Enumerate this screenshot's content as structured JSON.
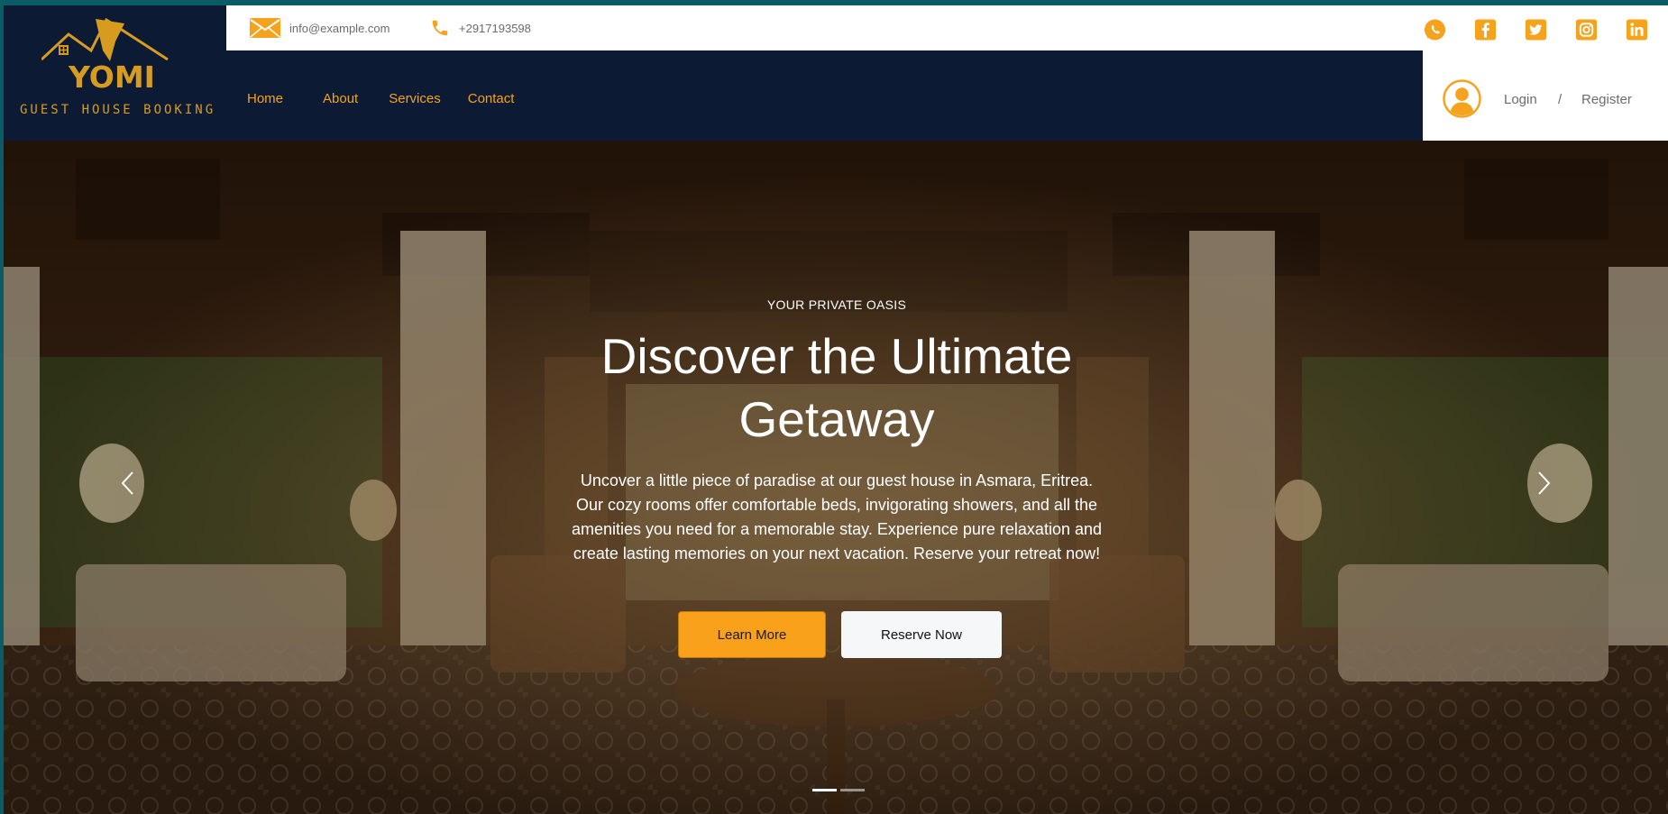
{
  "brand": {
    "logo_text": "YOMI",
    "tagline": "GUEST HOUSE BOOKING"
  },
  "contact": {
    "email": "info@example.com",
    "phone": "+2917193598"
  },
  "socials": [
    {
      "name": "whatsapp-icon"
    },
    {
      "name": "facebook-icon"
    },
    {
      "name": "twitter-icon"
    },
    {
      "name": "instagram-icon"
    },
    {
      "name": "linkedin-icon"
    }
  ],
  "nav": {
    "items": [
      {
        "label": "Home"
      },
      {
        "label": "About"
      },
      {
        "label": "Services"
      },
      {
        "label": "Contact"
      }
    ]
  },
  "account": {
    "login_label": "Login",
    "separator": "/",
    "register_label": "Register"
  },
  "hero": {
    "eyebrow": "YOUR PRIVATE OASIS",
    "title": "Discover the Ultimate Getaway",
    "description": "Uncover a little piece of paradise at our guest house in Asmara, Eritrea. Our cozy rooms offer comfortable beds, invigorating showers, and all the amenities you need for a memorable stay. Experience pure relaxation and create lasting memories on your next vacation. Reserve your retreat now!",
    "primary_button": "Learn More",
    "secondary_button": "Reserve Now",
    "slide_count": 2,
    "active_slide": 1
  },
  "colors": {
    "accent": "#f9a11b",
    "header_bg": "#0c1a33",
    "teal_strip": "#0b5c66"
  }
}
